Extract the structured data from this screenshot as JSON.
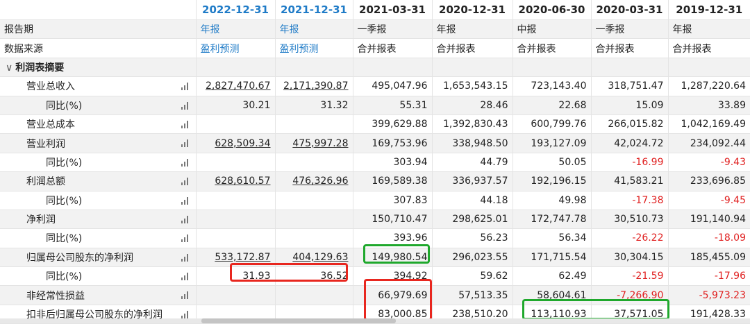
{
  "columns": [
    {
      "date": "2022-12-31",
      "forecast": true
    },
    {
      "date": "2021-12-31",
      "forecast": true
    },
    {
      "date": "2021-03-31",
      "forecast": false
    },
    {
      "date": "2020-12-31",
      "forecast": false
    },
    {
      "date": "2020-06-30",
      "forecast": false
    },
    {
      "date": "2020-03-31",
      "forecast": false
    },
    {
      "date": "2019-12-31",
      "forecast": false
    }
  ],
  "rows": {
    "report_period": {
      "label": "报告期",
      "values": [
        "年报",
        "年报",
        "一季报",
        "年报",
        "中报",
        "一季报",
        "年报"
      ]
    },
    "data_source": {
      "label": "数据来源",
      "values": [
        "盈利预测",
        "盈利预测",
        "合并报表",
        "合并报表",
        "合并报表",
        "合并报表",
        "合并报表"
      ]
    },
    "section": {
      "label": "利润表摘要",
      "chevron": "∨"
    },
    "revenue": {
      "label": "营业总收入",
      "values": [
        "2,827,470.67",
        "2,171,390.87",
        "495,047.96",
        "1,653,543.15",
        "723,143.40",
        "318,751.47",
        "1,287,220.64"
      ]
    },
    "revenue_yoy": {
      "label": "同比(%)",
      "values": [
        "30.21",
        "31.32",
        "55.31",
        "28.46",
        "22.68",
        "15.09",
        "33.89"
      ]
    },
    "total_cost": {
      "label": "营业总成本",
      "values": [
        "",
        "",
        "399,629.88",
        "1,392,830.43",
        "600,799.76",
        "266,015.82",
        "1,042,169.49"
      ]
    },
    "op_profit": {
      "label": "营业利润",
      "values": [
        "628,509.34",
        "475,997.28",
        "169,753.96",
        "338,948.50",
        "193,127.09",
        "42,024.72",
        "234,092.44"
      ]
    },
    "op_profit_yoy": {
      "label": "同比(%)",
      "values": [
        "",
        "",
        "303.94",
        "44.79",
        "50.05",
        "-16.99",
        "-9.43"
      ]
    },
    "total_profit": {
      "label": "利润总额",
      "values": [
        "628,610.57",
        "476,326.96",
        "169,589.38",
        "336,937.57",
        "192,196.15",
        "41,583.21",
        "233,696.85"
      ]
    },
    "total_profit_yoy": {
      "label": "同比(%)",
      "values": [
        "",
        "",
        "307.83",
        "44.18",
        "49.98",
        "-17.38",
        "-9.45"
      ]
    },
    "net_profit": {
      "label": "净利润",
      "values": [
        "",
        "",
        "150,710.47",
        "298,625.01",
        "172,747.78",
        "30,510.73",
        "191,140.94"
      ]
    },
    "net_profit_yoy": {
      "label": "同比(%)",
      "values": [
        "",
        "",
        "393.96",
        "56.23",
        "56.34",
        "-26.22",
        "-18.09"
      ]
    },
    "parent_np": {
      "label": "归属母公司股东的净利润",
      "values": [
        "533,172.87",
        "404,129.63",
        "149,980.54",
        "296,023.55",
        "171,715.54",
        "30,304.15",
        "185,455.09"
      ]
    },
    "parent_np_yoy": {
      "label": "同比(%)",
      "values": [
        "31.93",
        "36.52",
        "394.92",
        "59.62",
        "62.49",
        "-21.59",
        "-17.96"
      ]
    },
    "non_recurring": {
      "label": "非经常性损益",
      "values": [
        "",
        "",
        "66,979.69",
        "57,513.35",
        "58,604.61",
        "-7,266.90",
        "-5,973.23"
      ]
    },
    "deducted_np": {
      "label": "扣非后归属母公司股东的净利润",
      "values": [
        "",
        "",
        "83,000.85",
        "238,510.20",
        "113,110.93",
        "37,571.05",
        "191,428.33"
      ]
    }
  }
}
